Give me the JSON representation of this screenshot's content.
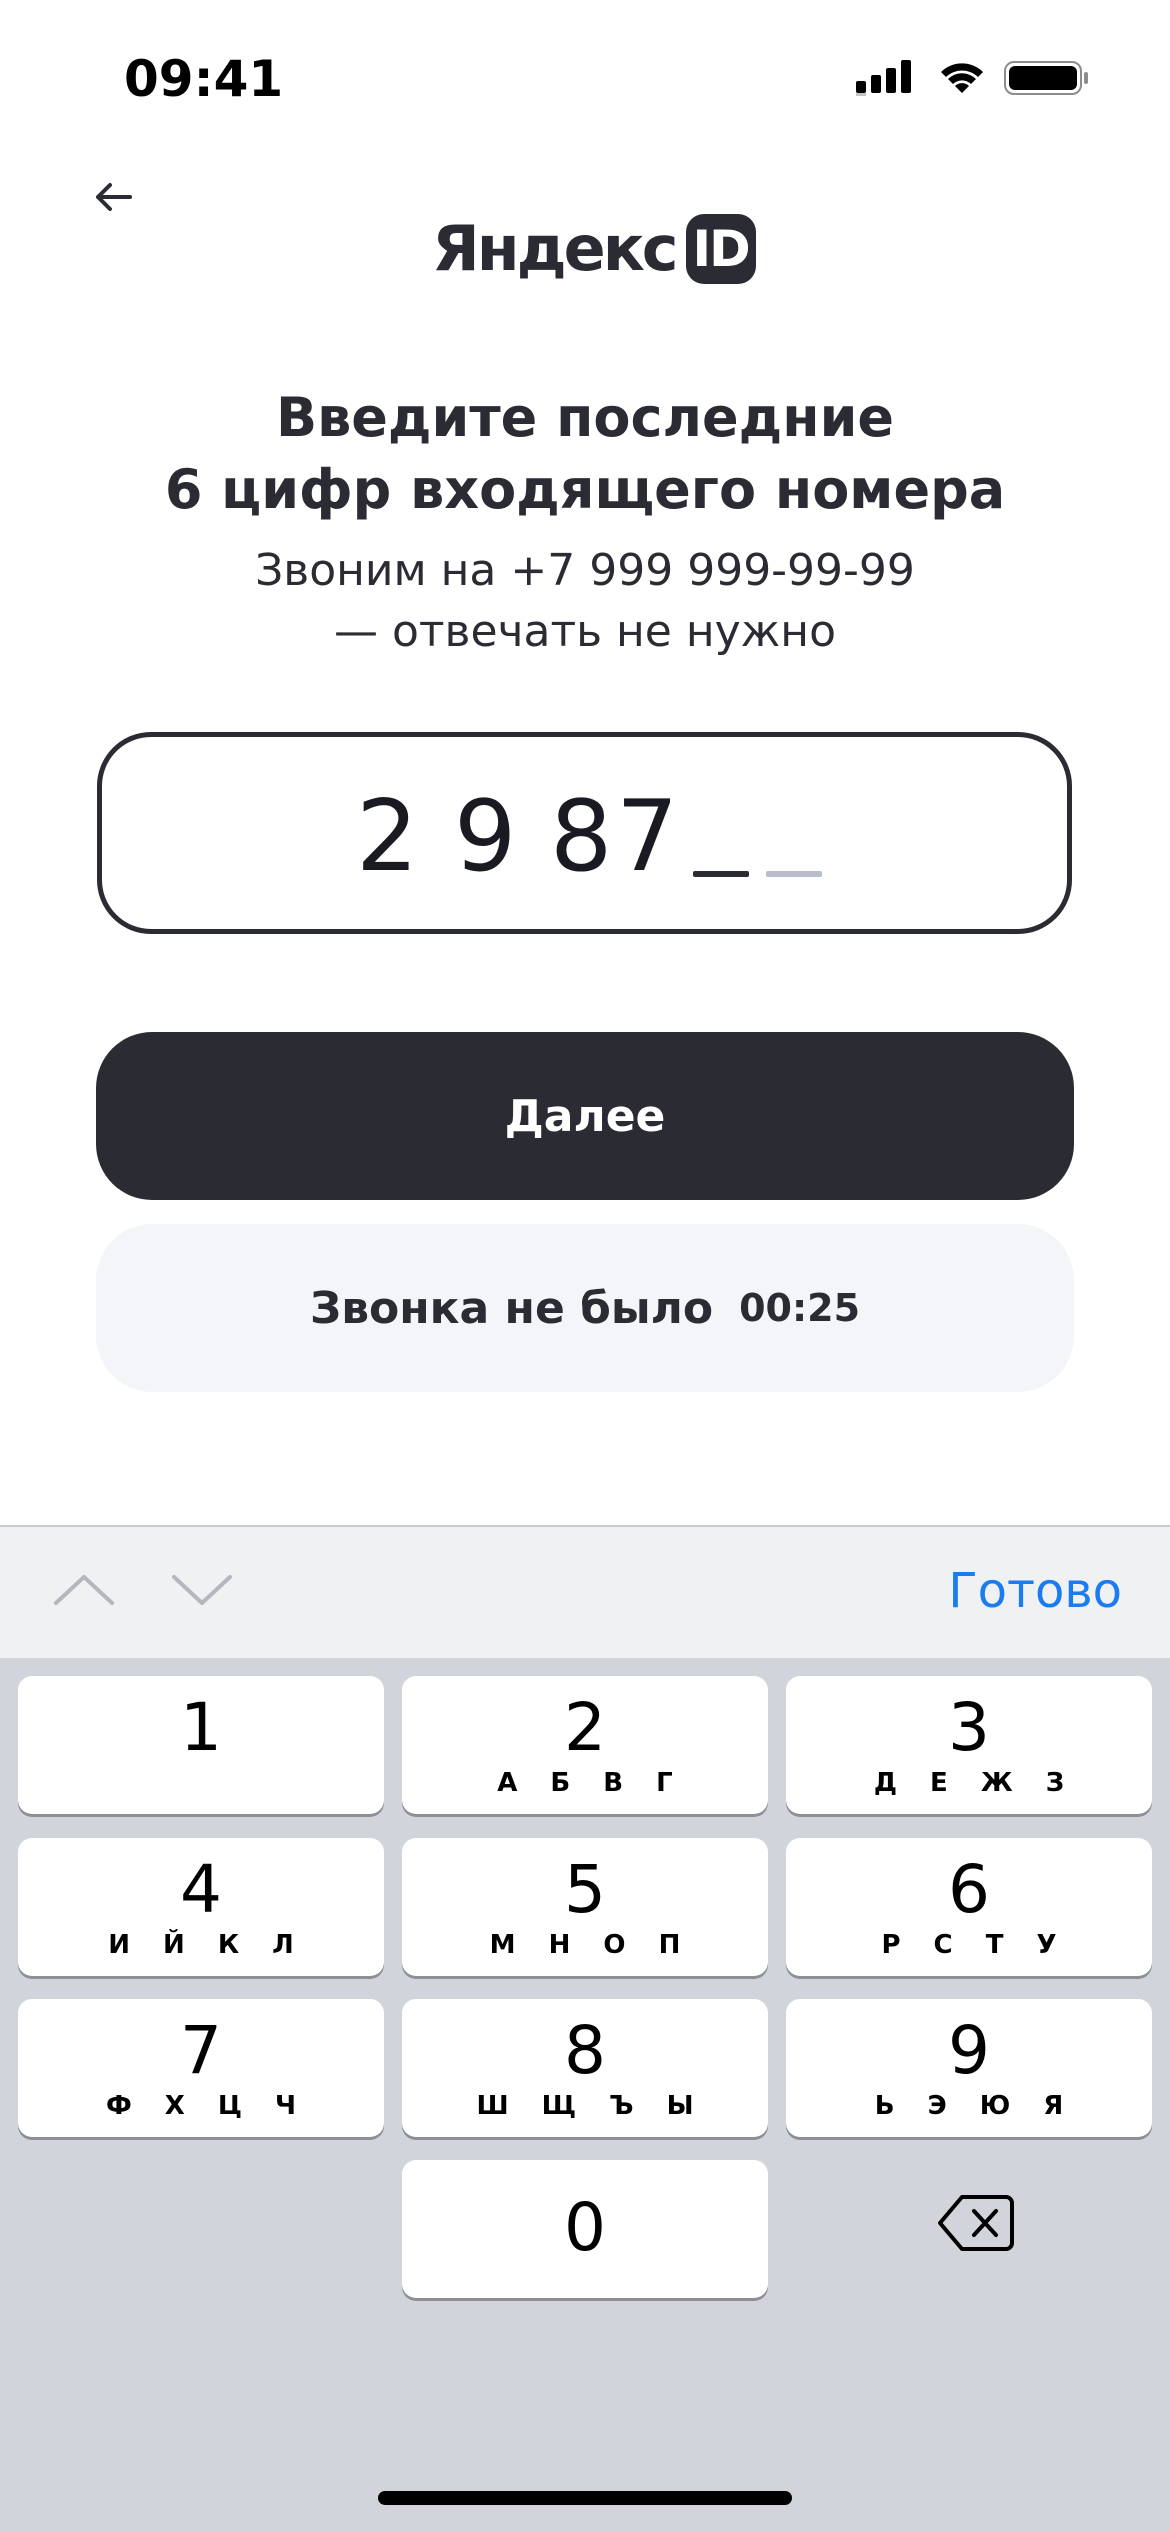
{
  "status_bar": {
    "time": "09:41",
    "signal_icon": "cellular-signal-icon",
    "wifi_icon": "wifi-icon",
    "battery_icon": "battery-icon"
  },
  "header": {
    "back_icon": "arrow-left-icon",
    "logo_text": "Яндекс",
    "logo_badge": "ID"
  },
  "main": {
    "title_line1": "Введите последние",
    "title_line2": "6 цифр входящего номера",
    "subtitle_line1": "Звоним на +7 999 999-99-99",
    "subtitle_line2": "— отвечать не нужно",
    "code": {
      "digits": [
        "2",
        "9",
        "8",
        "7"
      ],
      "total_length": 6,
      "filled_count": 4
    },
    "next_button_label": "Далее",
    "no_call_label": "Звонка не было",
    "no_call_timer": "00:25"
  },
  "keyboard": {
    "accessory": {
      "up_icon": "chevron-up-icon",
      "down_icon": "chevron-down-icon",
      "done_label": "Готово"
    },
    "keys": [
      {
        "num": "1",
        "letters": ""
      },
      {
        "num": "2",
        "letters": "А Б В Г"
      },
      {
        "num": "3",
        "letters": "Д Е Ж З"
      },
      {
        "num": "4",
        "letters": "И Й К Л"
      },
      {
        "num": "5",
        "letters": "М Н О П"
      },
      {
        "num": "6",
        "letters": "Р С Т У"
      },
      {
        "num": "7",
        "letters": "Ф Х Ц Ч"
      },
      {
        "num": "8",
        "letters": "Ш Щ Ъ Ы"
      },
      {
        "num": "9",
        "letters": "Ь Э Ю Я"
      },
      {
        "num": "0",
        "letters": ""
      }
    ],
    "backspace_icon": "backspace-icon"
  },
  "colors": {
    "text_primary": "#2b2b33",
    "button_dark": "#2b2b33",
    "button_light": "#f4f5f8",
    "accent_blue": "#1a7cf0",
    "keypad_bg": "#d1d4db",
    "underscore_active": "#2b2b33",
    "underscore_inactive": "#b8bccb"
  }
}
